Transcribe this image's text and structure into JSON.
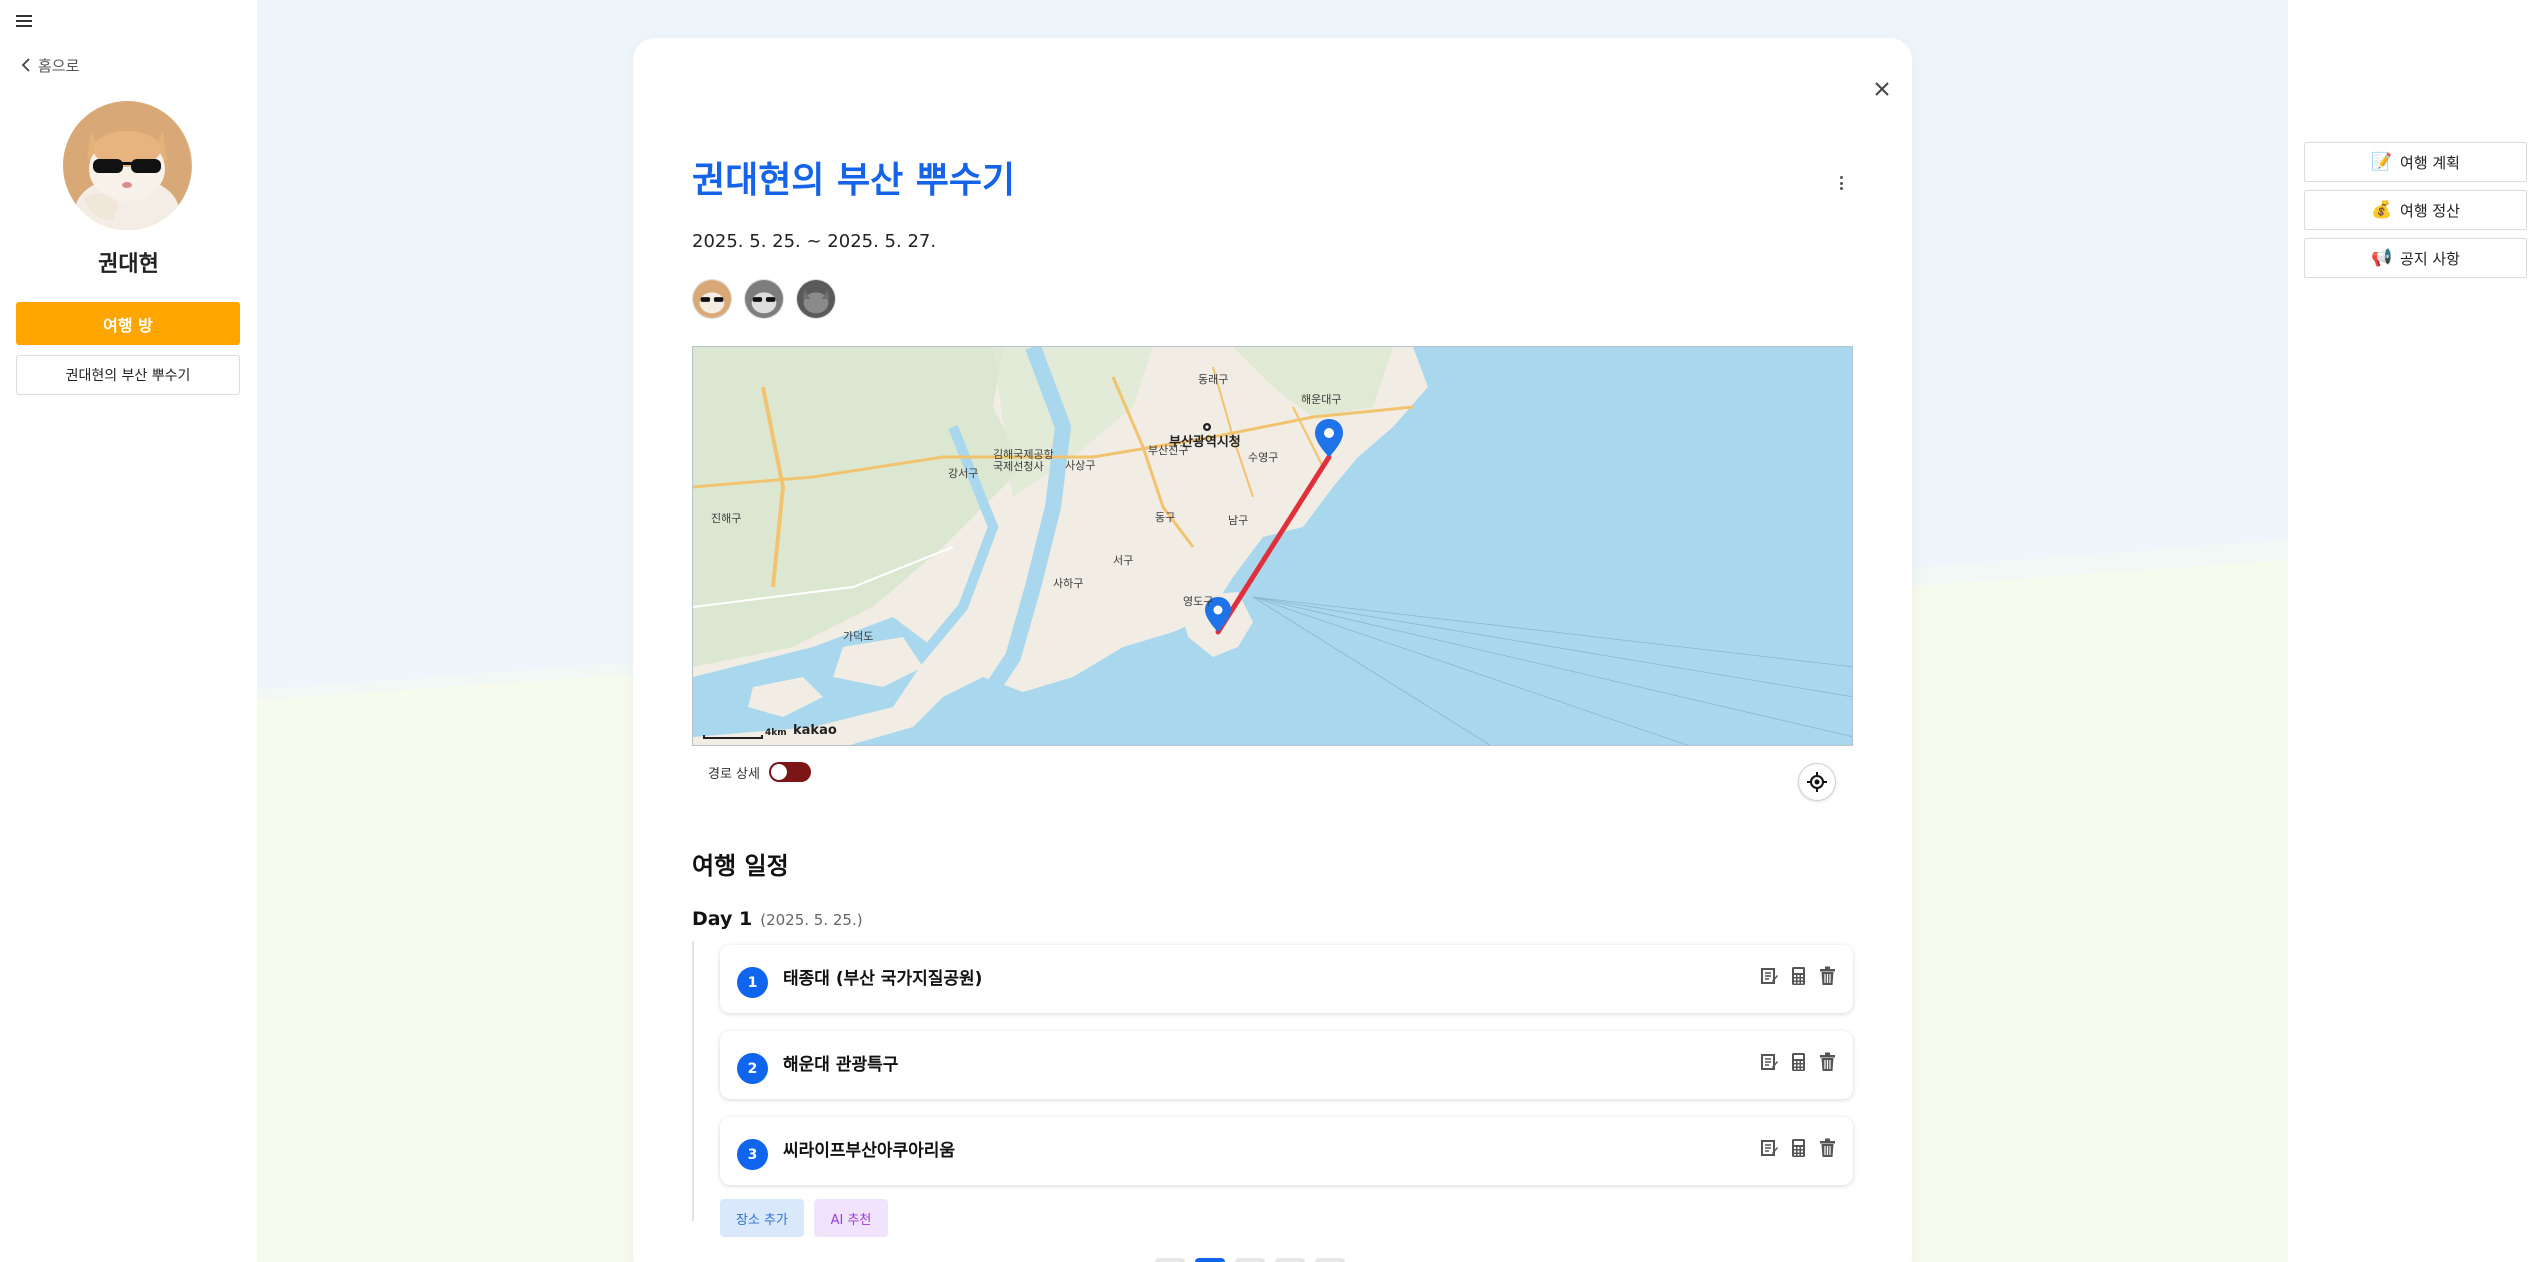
{
  "sidebar": {
    "back_label": "홈으로",
    "user_name": "권대현",
    "trip_room_label": "여행 방",
    "trip_item_label": "권대현의 부산 뿌수기"
  },
  "right_panel": {
    "buttons": [
      {
        "label": "여행 계획",
        "icon": "clipboard-icon"
      },
      {
        "label": "여행 정산",
        "icon": "money-bag-icon"
      },
      {
        "label": "공지 사항",
        "icon": "megaphone-icon"
      }
    ]
  },
  "trip": {
    "title": "권대현의 부산 뿌수기",
    "dates": "2025. 5. 25. ~ 2025. 5. 27.",
    "member_count": 3
  },
  "map": {
    "provider": "kakao",
    "scale": "4km",
    "labels": {
      "city_hall": "부산광역시청",
      "haeundae": "해운대구",
      "gangseo": "강서구",
      "saha": "사하구",
      "yeongdo": "영도구",
      "nam": "남구",
      "jinhae": "진해구",
      "gadeok": "가덕도",
      "sasang": "사상구",
      "dong": "동구",
      "seo": "서구",
      "suyeong": "수영구",
      "busanjin": "부산진구",
      "dongnae": "동래구",
      "gimhae_airport": "김해국제공항 국제선청사"
    }
  },
  "route_toggle_label": "경로 상세",
  "schedule": {
    "section_title": "여행 일정",
    "day_label": "Day 1",
    "day_date": "(2025. 5. 25.)",
    "places": [
      {
        "num": "1",
        "name": "태종대 (부산 국가지질공원)"
      },
      {
        "num": "2",
        "name": "해운대 관광특구"
      },
      {
        "num": "3",
        "name": "씨라이프부산아쿠아리움"
      }
    ],
    "add_place_label": "장소 추가",
    "ai_recommend_label": "AI 추천"
  },
  "colors": {
    "accent_blue": "#1463e8",
    "orange": "#ffa500",
    "route_red": "#e0303c",
    "toggle_on": "#7c1616"
  }
}
